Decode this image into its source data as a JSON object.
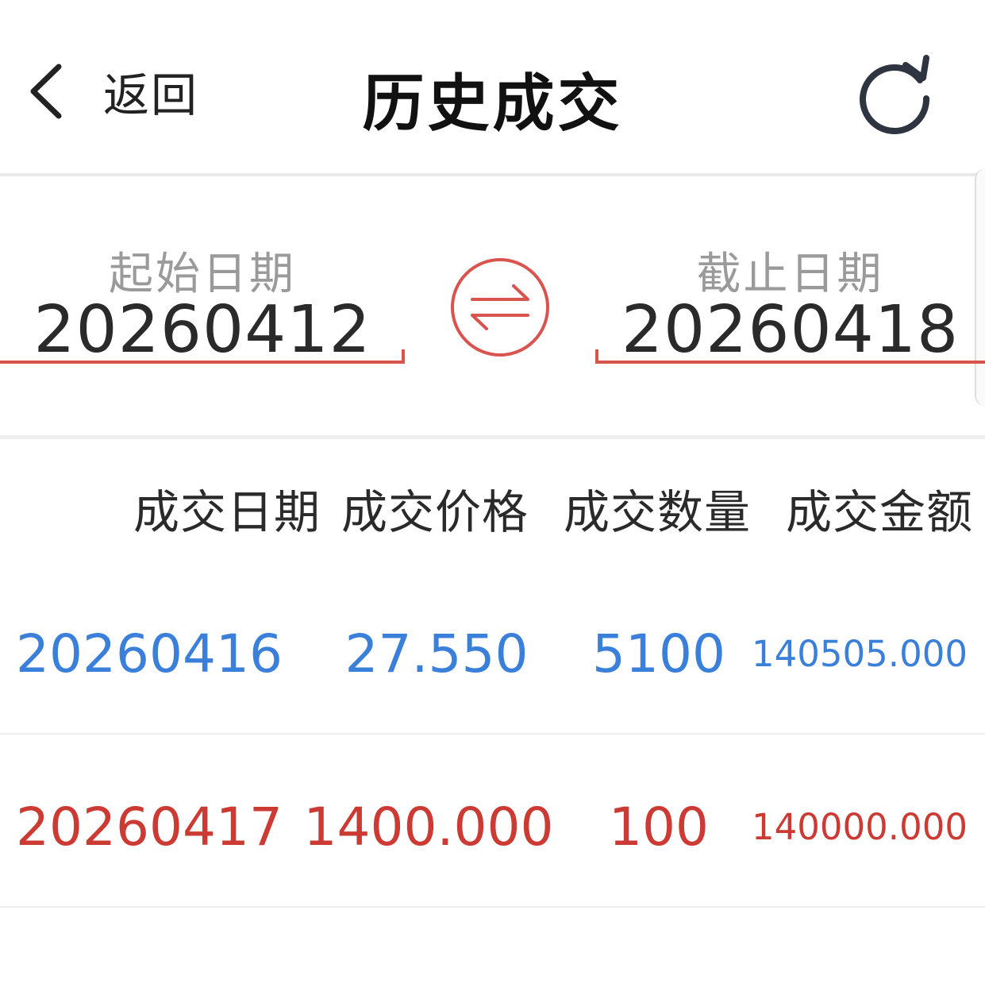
{
  "header": {
    "back_label": "返回",
    "title": "历史成交",
    "icons": {
      "back": "chevron-left-icon",
      "refresh": "refresh-icon"
    }
  },
  "filter": {
    "start_label": "起始日期",
    "start_value": "20260412",
    "end_label": "截止日期",
    "end_value": "20260418",
    "swap_icon": "swap-arrows-icon",
    "accent_color": "#d9534f"
  },
  "table": {
    "columns": [
      "成交日期",
      "成交价格",
      "成交数量",
      "成交金额"
    ],
    "rows": [
      {
        "date": "20260416",
        "price": "27.550",
        "qty": "5100",
        "amount": "140505.000",
        "color": "#3a7fd9"
      },
      {
        "date": "20260417",
        "price": "1400.000",
        "qty": "100",
        "amount": "140000.000",
        "color": "#cc3b33"
      }
    ]
  }
}
